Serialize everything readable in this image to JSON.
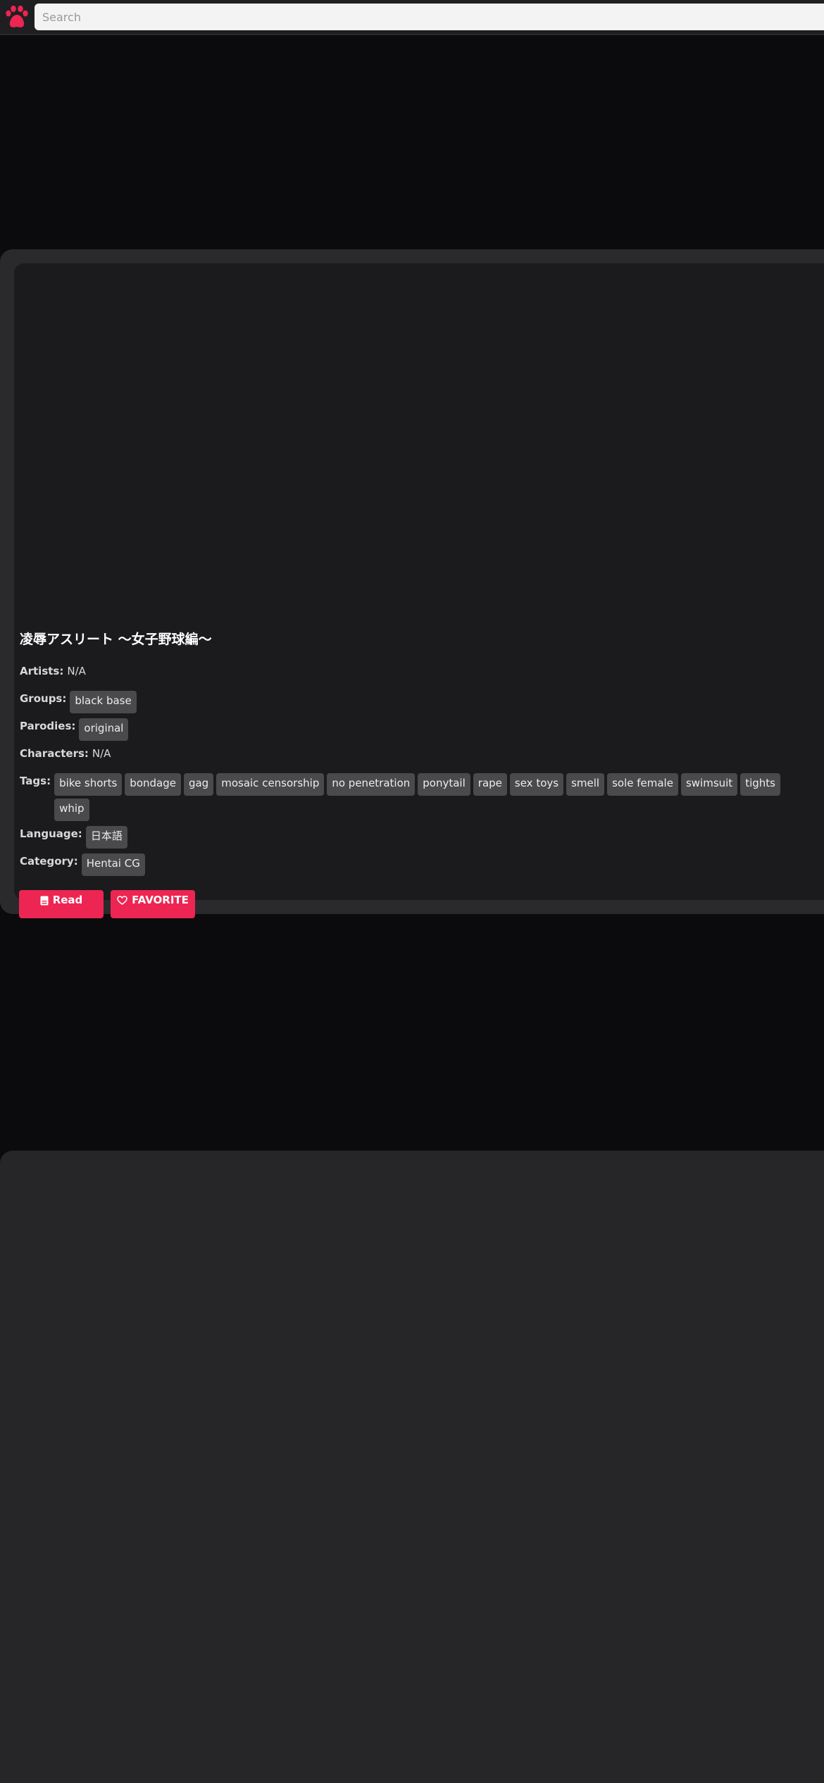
{
  "header": {
    "search_placeholder": "Search",
    "logo_icon": "paw-icon",
    "accent_color": "#ed2553"
  },
  "gallery": {
    "title": "凌辱アスリート 〜女子野球編〜",
    "artists": {
      "label": "Artists:",
      "value": "N/A"
    },
    "groups": {
      "label": "Groups:",
      "tags": [
        "black base"
      ]
    },
    "parodies": {
      "label": "Parodies:",
      "tags": [
        "original"
      ]
    },
    "characters": {
      "label": "Characters:",
      "value": "N/A"
    },
    "tags_row": {
      "label": "Tags:",
      "tags": [
        "bike shorts",
        "bondage",
        "gag",
        "mosaic censorship",
        "no penetration",
        "ponytail",
        "rape",
        "sex toys",
        "smell",
        "sole female",
        "swimsuit",
        "tights",
        "whip"
      ]
    },
    "language": {
      "label": "Language:",
      "tags": [
        "日本語"
      ]
    },
    "category": {
      "label": "Category:",
      "tags": [
        "Hentai CG"
      ]
    },
    "buttons": {
      "read_label": "Read",
      "read_icon": "book-icon",
      "favorite_label": "FAVORITE",
      "favorite_icon": "heart-icon"
    }
  }
}
